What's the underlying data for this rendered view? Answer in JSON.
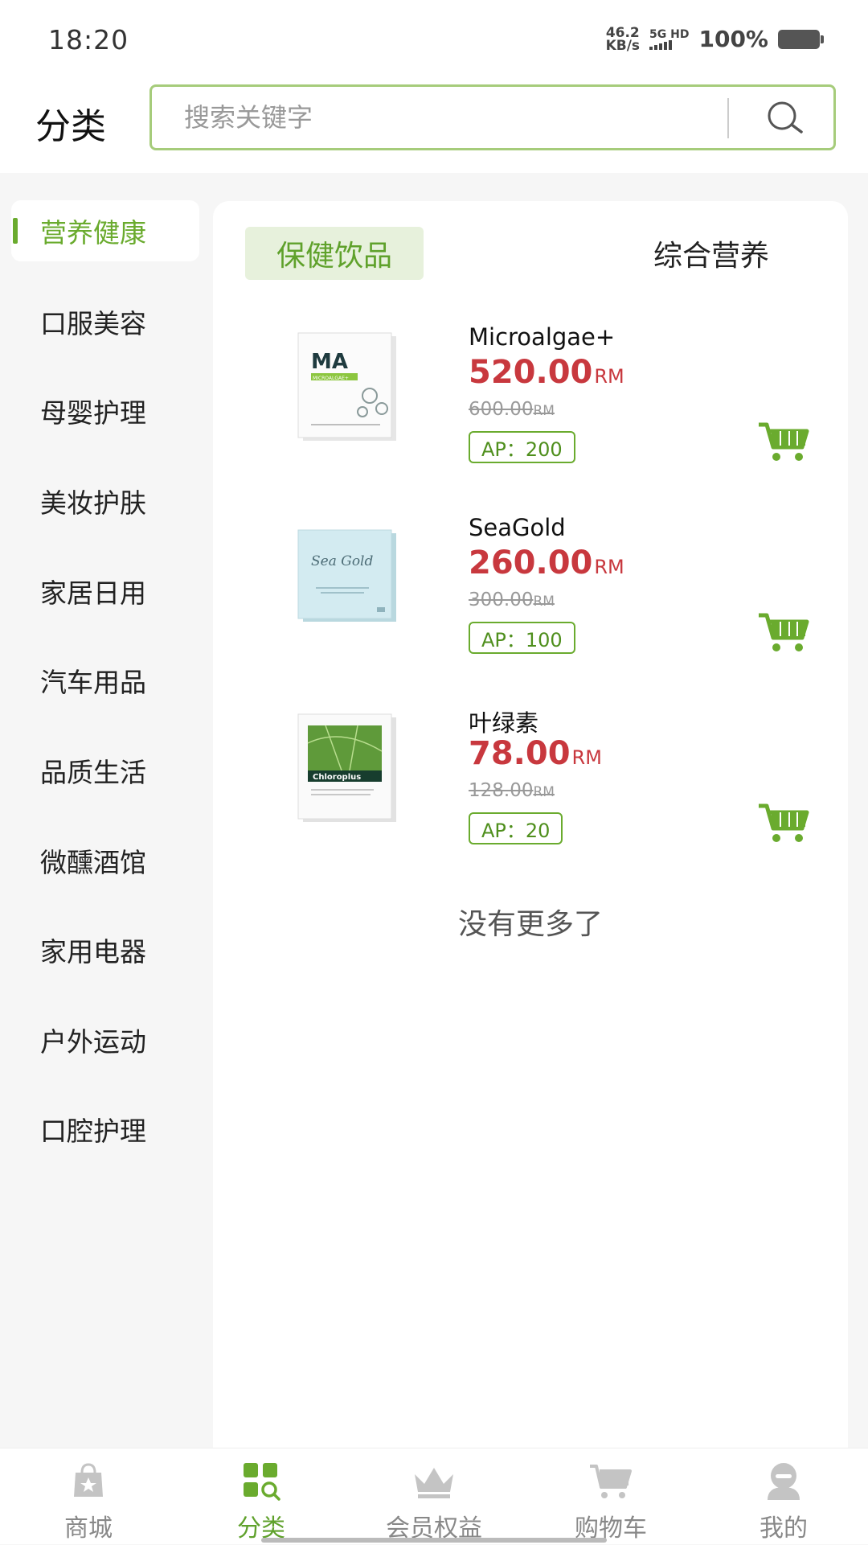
{
  "status_bar": {
    "time": "18:20",
    "net_speed_value": "46.2",
    "net_speed_unit": "KB/s",
    "net_type": "5G HD",
    "battery": "100%"
  },
  "header": {
    "title": "分类",
    "search_placeholder": "搜索关键字",
    "search_value": ""
  },
  "sidebar": {
    "items": [
      {
        "label": "营养健康",
        "active": true
      },
      {
        "label": "口服美容"
      },
      {
        "label": "母婴护理"
      },
      {
        "label": "美妆护肤"
      },
      {
        "label": "家居日用"
      },
      {
        "label": "汽车用品"
      },
      {
        "label": "品质生活"
      },
      {
        "label": "微醺酒馆"
      },
      {
        "label": "家用电器"
      },
      {
        "label": "户外运动"
      },
      {
        "label": "口腔护理"
      }
    ]
  },
  "tabs": [
    {
      "label": "保健饮品",
      "active": true
    },
    {
      "label": "综合营养"
    }
  ],
  "products": [
    {
      "name": "Microalgae+",
      "price": "520.00",
      "currency": "RM",
      "old_price": "600.00",
      "ap": "AP：200",
      "image": "ma-box"
    },
    {
      "name": "SeaGold",
      "price": "260.00",
      "currency": "RM",
      "old_price": "300.00",
      "ap": "AP：100",
      "image": "seagold-box"
    },
    {
      "name": "叶绿素",
      "price": "78.00",
      "currency": "RM",
      "old_price": "128.00",
      "ap": "AP：20",
      "image": "chloroplus-box"
    }
  ],
  "product_image_text": {
    "ma_logo": "MA",
    "ma_sub": "MICROALGAE+",
    "seagold_script": "Sea Gold",
    "chloro_label": "Chloroplus"
  },
  "no_more": "没有更多了",
  "tabbar": [
    {
      "label": "商城",
      "icon": "shop-bag-icon"
    },
    {
      "label": "分类",
      "icon": "category-search-icon",
      "active": true
    },
    {
      "label": "会员权益",
      "icon": "crown-icon"
    },
    {
      "label": "购物车",
      "icon": "cart-icon"
    },
    {
      "label": "我的",
      "icon": "profile-icon"
    }
  ],
  "colors": {
    "accent": "#6aab2e",
    "price": "#c8383e",
    "search_border": "#a6cc7b",
    "tab_active_bg": "#e7f1dc"
  }
}
